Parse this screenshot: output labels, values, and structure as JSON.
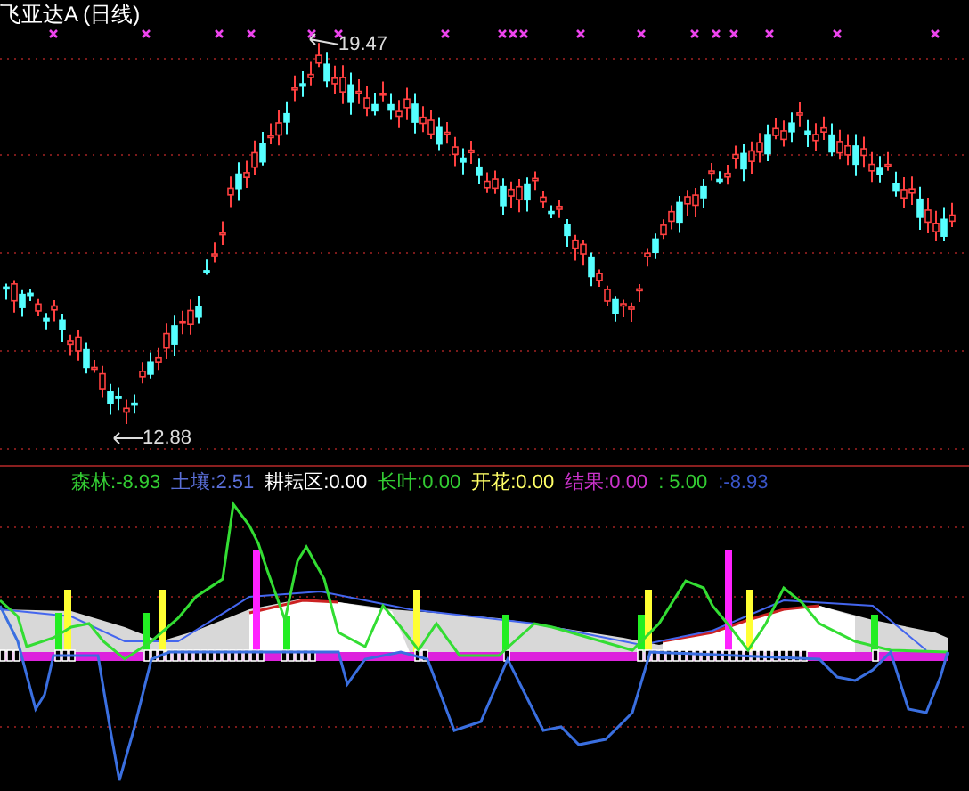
{
  "title": "飞亚达A (日线)",
  "price_high": "19.47",
  "price_low": "12.88",
  "legend": [
    {
      "label": "森林:",
      "value": "-8.93",
      "color": "#33cc33"
    },
    {
      "label": "土壤:",
      "value": "2.51",
      "color": "#5a6fd8"
    },
    {
      "label": "耕耘区:",
      "value": "0.00",
      "color": "#ffffff"
    },
    {
      "label": "长叶:",
      "value": "0.00",
      "color": "#33cc33"
    },
    {
      "label": "开花:",
      "value": "0.00",
      "color": "#ffff66"
    },
    {
      "label": "结果:",
      "value": "0.00",
      "color": "#cc33cc"
    },
    {
      "value": ": 5.00",
      "color": "#33cc33"
    },
    {
      "value": ":-8.93",
      "color": "#3a55c8"
    }
  ]
}
